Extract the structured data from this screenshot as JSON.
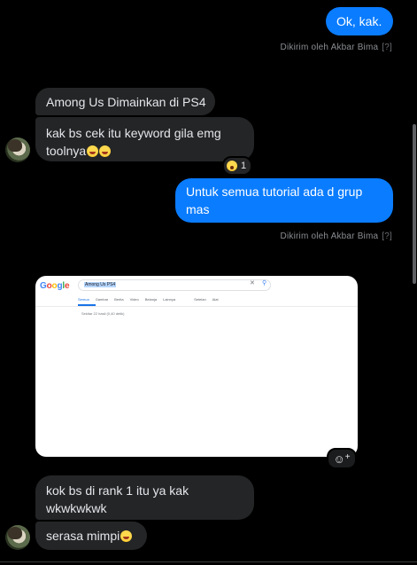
{
  "messages": {
    "m1": {
      "text": "Ok, kak."
    },
    "m1_meta": {
      "sender_prefix": "Dikirim oleh Akbar Bima",
      "help": "[?]"
    },
    "m2": {
      "text": "Among Us Dimainkan di PS4"
    },
    "m3": {
      "text_line1": "kak bs cek itu keyword gila emg",
      "text_line2": "toolnya"
    },
    "m3_reaction": {
      "count": "1"
    },
    "m4": {
      "text_line1": "Untuk semua tutorial ada d grup",
      "text_line2": "mas"
    },
    "m4_meta": {
      "sender_prefix": "Dikirim oleh Akbar Bima",
      "help": "[?]"
    },
    "attachment": {
      "logo": "Google",
      "query": "Among Us PS4",
      "tabs": [
        "Semua",
        "Gambar",
        "Berita",
        "Video",
        "Belanja",
        "Lainnya",
        "Setelan",
        "Alat"
      ],
      "result_stats": "Sekitar 22 hasil (0,40 detik)"
    },
    "m5": {
      "text_line1": "kok bs di rank 1 itu ya kak",
      "text_line2": "wkwkwkwk"
    },
    "m6": {
      "text": "serasa mimpi"
    }
  },
  "icons": {
    "laugh_emoji": "grinning-squinting-face",
    "react_emoji": "astonished-face",
    "add_reaction": "smiley-plus"
  },
  "colors": {
    "outgoing_bubble": "#0a7cff",
    "incoming_bubble": "#242526",
    "background": "#000000"
  }
}
